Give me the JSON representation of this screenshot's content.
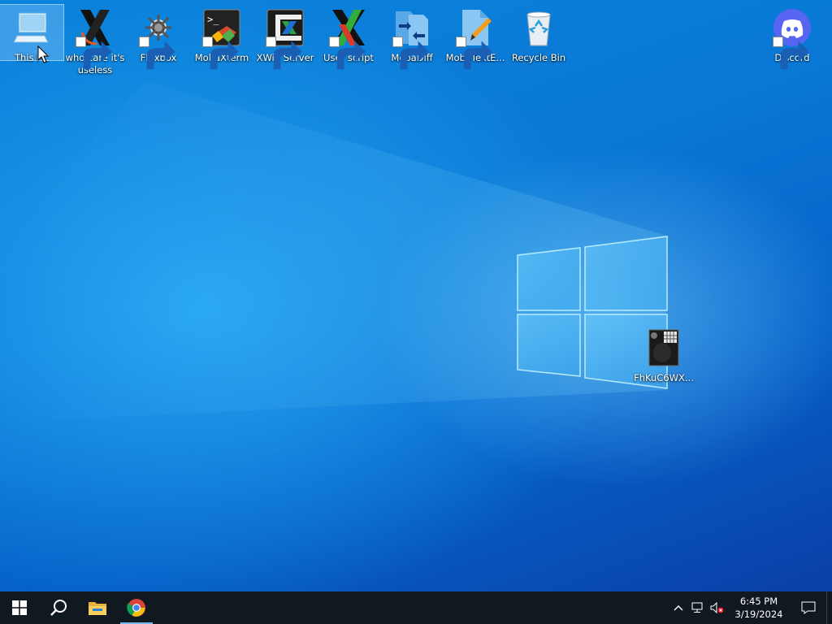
{
  "desktop": {
    "icons": [
      {
        "label": "This PC",
        "icon": "this-pc-icon",
        "shortcut": false,
        "selected": true
      },
      {
        "label": "who care it's useless",
        "icon": "x-server-icon",
        "shortcut": true
      },
      {
        "label": "Fluxbox",
        "icon": "fluxbox-icon",
        "shortcut": true
      },
      {
        "label": "MobaXterm",
        "icon": "mobaxterm-icon",
        "shortcut": true
      },
      {
        "label": "XWin Server",
        "icon": "xwin-server-icon",
        "shortcut": true
      },
      {
        "label": "User script",
        "icon": "x-script-icon",
        "shortcut": true
      },
      {
        "label": "MobaDiff",
        "icon": "mobadiff-icon",
        "shortcut": true
      },
      {
        "label": "MobaTextE...",
        "icon": "mobatexteditor-icon",
        "shortcut": true
      },
      {
        "label": "Recycle Bin",
        "icon": "recycle-bin-icon",
        "shortcut": false
      },
      {
        "label": "Discord",
        "icon": "discord-icon",
        "shortcut": true
      },
      {
        "label": "FhKuC6WX...",
        "icon": "image-file-icon",
        "shortcut": false
      }
    ]
  },
  "taskbar": {
    "start": "windows-start-icon",
    "search": "search-icon",
    "pinned": [
      {
        "name": "file-explorer",
        "icon": "folder-icon"
      },
      {
        "name": "chrome",
        "icon": "chrome-icon",
        "active": true
      }
    ],
    "tray": {
      "chevron": "chevron-up-icon",
      "network": "network-icon",
      "volume": "volume-muted-icon",
      "time": "6:45 PM",
      "date": "3/19/2024",
      "notifications": "notification-icon"
    }
  },
  "colors": {
    "taskbar": "#101820",
    "desktop_accent": "#0a78d6",
    "taskbar_active_indicator": "#76b9ed"
  }
}
